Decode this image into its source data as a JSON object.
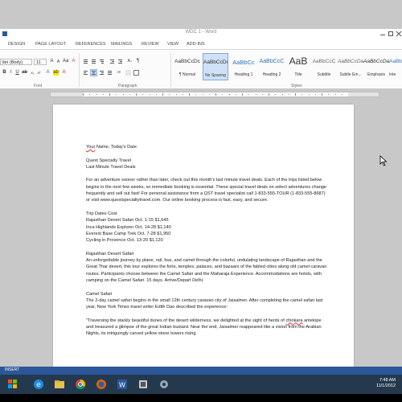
{
  "window": {
    "title": "WDC 1 - Word"
  },
  "ribbon_tabs": [
    "DESIGN",
    "PAGE LAYOUT",
    "REFERENCES",
    "MAILINGS",
    "REVIEW",
    "VIEW",
    "ADD-INS"
  ],
  "ribbon": {
    "font_name": "ibri (Body)",
    "font_size": "11",
    "group_labels": {
      "font": "Font",
      "paragraph": "Paragraph",
      "styles": "Styles"
    },
    "styles": [
      {
        "preview": "AaBbCcDc",
        "name": "¶ Normal"
      },
      {
        "preview": "AaBbCcDc",
        "name": "No Spacing"
      },
      {
        "preview": "AaBbCc",
        "name": "Heading 1"
      },
      {
        "preview": "AaBbCcC",
        "name": "Heading 2"
      },
      {
        "preview": "AaB",
        "name": "Title"
      },
      {
        "preview": "AaBbCcC",
        "name": "Subtitle"
      },
      {
        "preview": "AaBbCcDa",
        "name": "Subtle Em..."
      },
      {
        "preview": "AaBbCcDa",
        "name": "Emphasis"
      },
      {
        "preview": "AaBbCcDa",
        "name": "Inte"
      }
    ],
    "selected_style": "No Spacing"
  },
  "document": {
    "header_line_part1": "Your",
    "header_line_part2": " Name, Today's Date",
    "company": "Quest Specialty Travel",
    "subtitle": "Last Minute Travel Deals",
    "intro": "For an adventure sooner rather than later, check out this month's last minute travel deals. Each of the trips listed below begins in the next few weeks, so immediate booking is essential. These special travel deals on select adventures change frequently and sell out fast! For personal assistance from a QST travel specialist call 1-833-555-TOUR (1-833-555-8687) or visit www.questspecialtytravel.com. Our online booking process is fast, easy, and secure.",
    "trips_heading": "Trip Dates Cost",
    "trips": [
      "Rajasthan Desert Safari Oct. 1-15 $1,645",
      "Inca Highlands Explorer Oct. 14-28 $1,140",
      "Everest Base Camp Trek Oct. 7-28 $1,950",
      "Cycling in Provence Oct. 13-20 $1,120"
    ],
    "section1_heading": "Rajasthan Desert Safari",
    "section1_body": "An unforgettable journey by plane, rail, bus, and camel through the colorful, undulating landscape of Rajasthan and the Great Thar desert, this tour explores the forts, temples, palaces, and bazaars of the fabled cities along old camel caravan routes. Participants choose between the Camel Safari and the Maharaja Experience. Accommodations are hotels, with camping on the Camel Safari. 15 days. Arrive/Depart Delhi.",
    "section2_heading": "Camel Safari",
    "section2_body": "The 2-day camel safari begins in the small 12th century caravan city of Jaisalmer. After completing the camel safari last year, New York Times travel writer Edith Dao described the experience:",
    "quote_part1": "\"Traversing the starkly beautiful dunes of the desert wilderness, we delighted at the sight of herds of ",
    "quote_misspelled": "chinkara",
    "quote_part2": " antelope and treasured a glimpse of the great Indian bustard. Near the end, Jaisalmer reappeared like a vision from the Arabian Nights, its intriguingly carved yellow stone towers rising"
  },
  "statusbar": {
    "text": "INSERT"
  },
  "taskbar": {
    "clock_time": "7:48 AM",
    "clock_date": "11/1/2012",
    "icons": [
      "ie-icon",
      "explorer-icon",
      "chrome-icon",
      "firefox-icon",
      "word-icon",
      "app-icon",
      "app-icon",
      "app-icon"
    ]
  },
  "colors": {
    "accent": "#2b579a",
    "taskbar": "#25394e",
    "selected_style": "#cfe1f7"
  }
}
